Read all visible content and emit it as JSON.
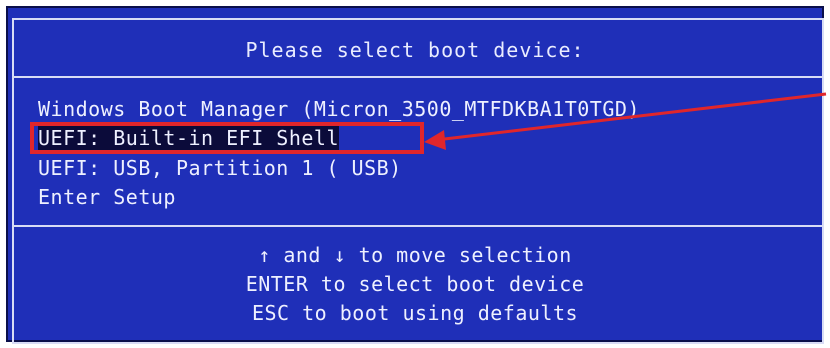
{
  "title": "Please select boot device:",
  "boot_devices": [
    {
      "label": "Windows Boot Manager (Micron_3500_MTFDKBA1T0TGD)"
    },
    {
      "label": "UEFI: Built-in EFI Shell"
    },
    {
      "label": "UEFI:  USB, Partition 1 ( USB)"
    },
    {
      "label": "Enter Setup"
    }
  ],
  "selected_index": 1,
  "help": {
    "line1": "↑ and ↓ to move selection",
    "line2": "ENTER to select boot device",
    "line3": "ESC to boot using defaults"
  },
  "colors": {
    "background": "#1f2fb8",
    "text": "#eef0ff",
    "annotation": "#e0262b"
  }
}
